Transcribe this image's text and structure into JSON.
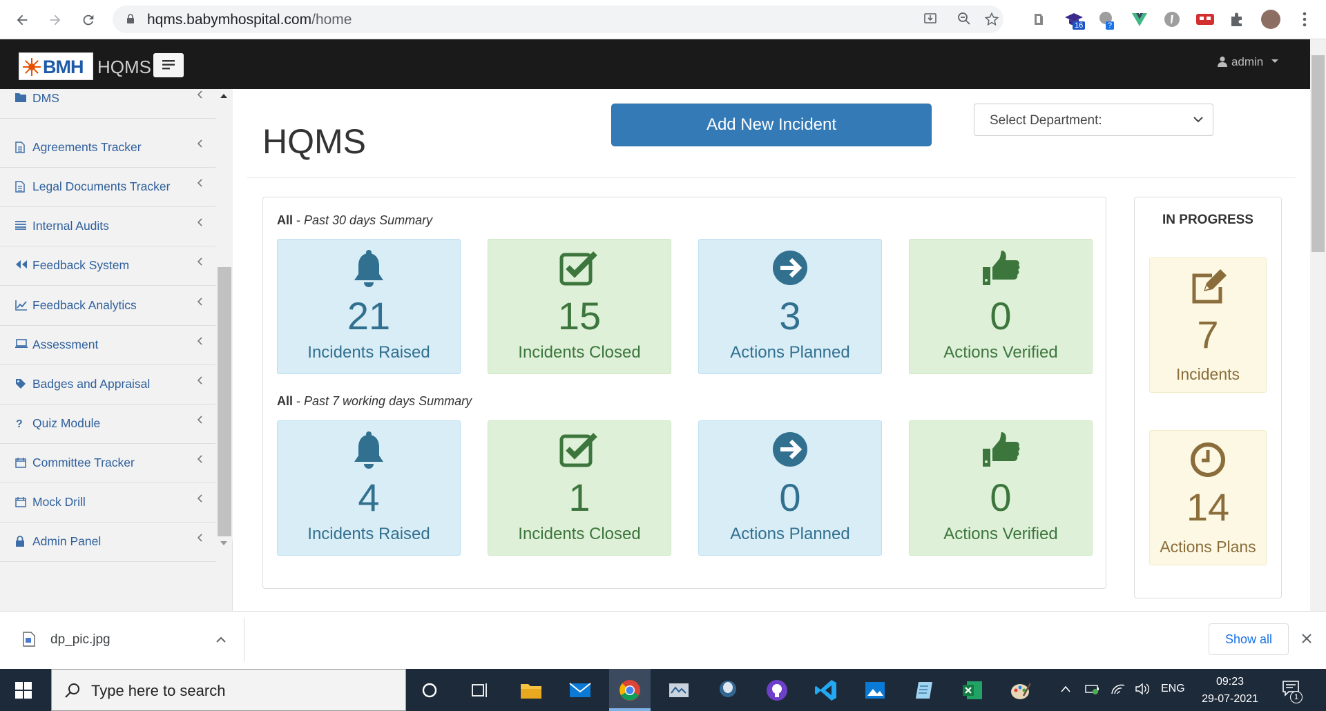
{
  "browser": {
    "url_host": "hqms.babymhospital.com",
    "url_path": "/home",
    "extension_badges": {
      "mortarboard": "16",
      "cloud": "?"
    }
  },
  "app": {
    "logo_text": "BMH",
    "title": "HQMS",
    "user": "admin"
  },
  "sidebar": {
    "items": [
      {
        "label": "DMS",
        "icon": "folder-icon"
      },
      {
        "label": "Agreements Tracker",
        "icon": "file-icon"
      },
      {
        "label": "Legal Documents Tracker",
        "icon": "file-icon"
      },
      {
        "label": "Internal Audits",
        "icon": "list-icon"
      },
      {
        "label": "Feedback System",
        "icon": "backward-icon"
      },
      {
        "label": "Feedback Analytics",
        "icon": "line-chart-icon"
      },
      {
        "label": "Assessment",
        "icon": "laptop-icon"
      },
      {
        "label": "Badges and Appraisal",
        "icon": "tag-icon"
      },
      {
        "label": "Quiz Module",
        "icon": "question-icon"
      },
      {
        "label": "Committee Tracker",
        "icon": "calendar-icon"
      },
      {
        "label": "Mock Drill",
        "icon": "calendar-icon"
      },
      {
        "label": "Admin Panel",
        "icon": "lock-icon"
      }
    ]
  },
  "main": {
    "page_title": "HQMS",
    "add_button": "Add New Incident",
    "department_select": "Select Department:",
    "summary_30": {
      "scope": "All",
      "sep": " - ",
      "period": "Past 30 days Summary",
      "cards": [
        {
          "value": "21",
          "label": "Incidents Raised",
          "tone": "blue",
          "icon": "bell-icon"
        },
        {
          "value": "15",
          "label": "Incidents Closed",
          "tone": "green",
          "icon": "check-square-icon"
        },
        {
          "value": "3",
          "label": "Actions Planned",
          "tone": "blue",
          "icon": "arrow-circle-right-icon"
        },
        {
          "value": "0",
          "label": "Actions Verified",
          "tone": "green",
          "icon": "thumbs-up-icon"
        }
      ]
    },
    "summary_7": {
      "scope": "All",
      "sep": " - ",
      "period": "Past 7 working days Summary",
      "cards": [
        {
          "value": "4",
          "label": "Incidents Raised",
          "tone": "blue",
          "icon": "bell-icon"
        },
        {
          "value": "1",
          "label": "Incidents Closed",
          "tone": "green",
          "icon": "check-square-icon"
        },
        {
          "value": "0",
          "label": "Actions Planned",
          "tone": "blue",
          "icon": "arrow-circle-right-icon"
        },
        {
          "value": "0",
          "label": "Actions Verified",
          "tone": "green",
          "icon": "thumbs-up-icon"
        }
      ]
    },
    "in_progress": {
      "title": "IN PROGRESS",
      "cards": [
        {
          "value": "7",
          "label": "Incidents",
          "icon": "edit-icon"
        },
        {
          "value": "14",
          "label": "Actions Plans",
          "icon": "clock-icon"
        }
      ]
    }
  },
  "downloads": {
    "file": "dp_pic.jpg",
    "show_all": "Show all"
  },
  "taskbar": {
    "search_placeholder": "Type here to search",
    "language": "ENG",
    "time": "09:23",
    "date": "29-07-2021",
    "notification_count": "1"
  },
  "colors": {
    "primary": "#337ab7",
    "info_bg": "#d9edf7",
    "success_bg": "#dff0d8",
    "warning_bg": "#fcf8e3",
    "header_bg": "#1a1a1a"
  }
}
